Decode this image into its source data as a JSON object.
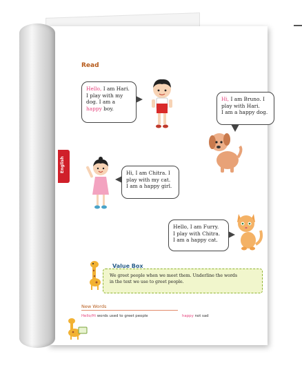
{
  "page": {
    "side_tab": "English",
    "heading": "Read"
  },
  "bubbles": {
    "hari": {
      "greet": "Hello,",
      "l1_rest": " I am Hari.",
      "l2": "I play with my",
      "l3": "dog. I am a",
      "happy": "happy",
      "l4_rest": " boy."
    },
    "bruno": {
      "greet": "Hi,",
      "l1_rest": " I am Bruno. I",
      "l2": "play with Hari.",
      "l3": "I am a happy dog."
    },
    "chitra": {
      "l1": "Hi, I am Chitra. I",
      "l2": "play with my cat.",
      "l3": "I am a happy girl."
    },
    "furry": {
      "l1": "Hello, I am Furry.",
      "l2": "I play with Chitra.",
      "l3": "I am a happy cat."
    }
  },
  "value_box": {
    "title": "Value Box",
    "text_l1": "We greet people when we meet them. Underline the words",
    "text_l2": "in the text we use to greet people."
  },
  "new_words": {
    "title": "New Words",
    "items": [
      {
        "word": "Hello/Hi",
        "meaning": " words used to greet people"
      },
      {
        "word": "happy",
        "meaning": " not sad"
      }
    ]
  },
  "colors": {
    "accent_red": "#d0202a",
    "heading_brown": "#b65a1a",
    "highlight_pink": "#e5417c",
    "value_box_bg": "#f1f6cc"
  },
  "icons": [
    "boy-illustration",
    "dog-illustration",
    "girl-illustration",
    "cat-illustration",
    "giraffe-icon",
    "giraffe-small-icon"
  ]
}
